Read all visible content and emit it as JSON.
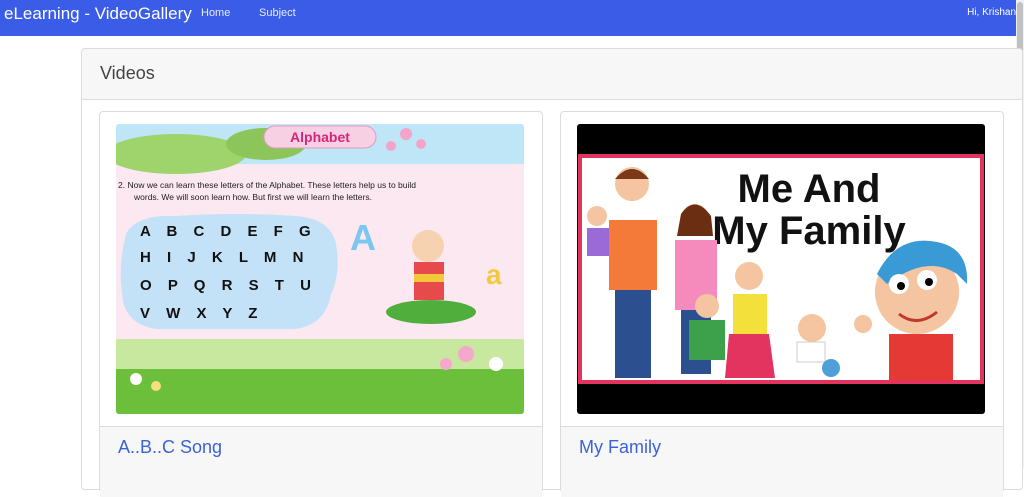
{
  "navbar": {
    "brand": "eLearning - VideoGallery",
    "links": [
      "Home",
      "Subject"
    ],
    "greeting": "Hi, Krishan"
  },
  "panel": {
    "title": "Videos"
  },
  "videos": [
    {
      "title": "A..B..C Song",
      "thumb_banner": "Alphabet",
      "thumb_text_line1": "2.  Now we can learn these letters of the Alphabet. These letters help us to build",
      "thumb_text_line2": "words. We will soon learn how. But first we will learn the letters.",
      "letter_rows": [
        "A B C D E F G",
        "H I J K L M N",
        "O P Q R S T U",
        "V W X Y Z"
      ]
    },
    {
      "title": "My Family",
      "thumb_line1": "Me And",
      "thumb_line2": "My Family"
    }
  ],
  "colors": {
    "navbar": "#3a5ce6",
    "link": "#3a63d8"
  }
}
